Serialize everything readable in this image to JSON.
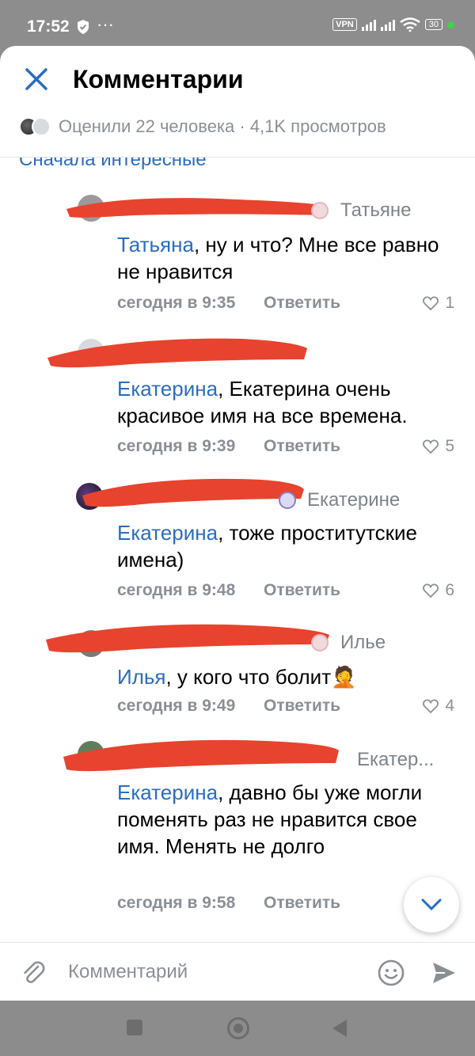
{
  "status": {
    "time": "17:52",
    "vpn": "VPN",
    "battery": "30"
  },
  "header": {
    "title": "Комментарии"
  },
  "liked": {
    "text": "Оценили 22 человека · 4,1K просмотров"
  },
  "sort": {
    "label": "Сначала интересные"
  },
  "answer_label": "Ответить",
  "comments": [
    {
      "reply_to": "Татьяне",
      "mention": "Татьяна",
      "text": ", ну и что? Мне все равно не нравится",
      "time": "сегодня в 9:35",
      "likes": "1"
    },
    {
      "reply_to": "",
      "mention": "Екатерина",
      "text": ", Екатерина очень красивое имя на все времена.",
      "time": "сегодня в 9:39",
      "likes": "5"
    },
    {
      "reply_to": "Екатерине",
      "mention": "Екатерина",
      "text": ", тоже проститутские имена)",
      "time": "сегодня в 9:48",
      "likes": "6"
    },
    {
      "reply_to": "Илье",
      "mention": "Илья",
      "text": ", у кого что болит",
      "emoji": "🤦",
      "time": "сегодня в 9:49",
      "likes": "4"
    },
    {
      "reply_to": "Екатер...",
      "mention": "Екатерина",
      "text": ", давно бы уже могли поменять раз не нравится свое имя.  Менять не долго",
      "time": "сегодня в 9:58",
      "likes": ""
    }
  ],
  "compose": {
    "placeholder": "Комментарий"
  },
  "colors": {
    "accent": "#2a6cc0",
    "muted": "#8a8f96",
    "redaction": "#e8432e"
  }
}
